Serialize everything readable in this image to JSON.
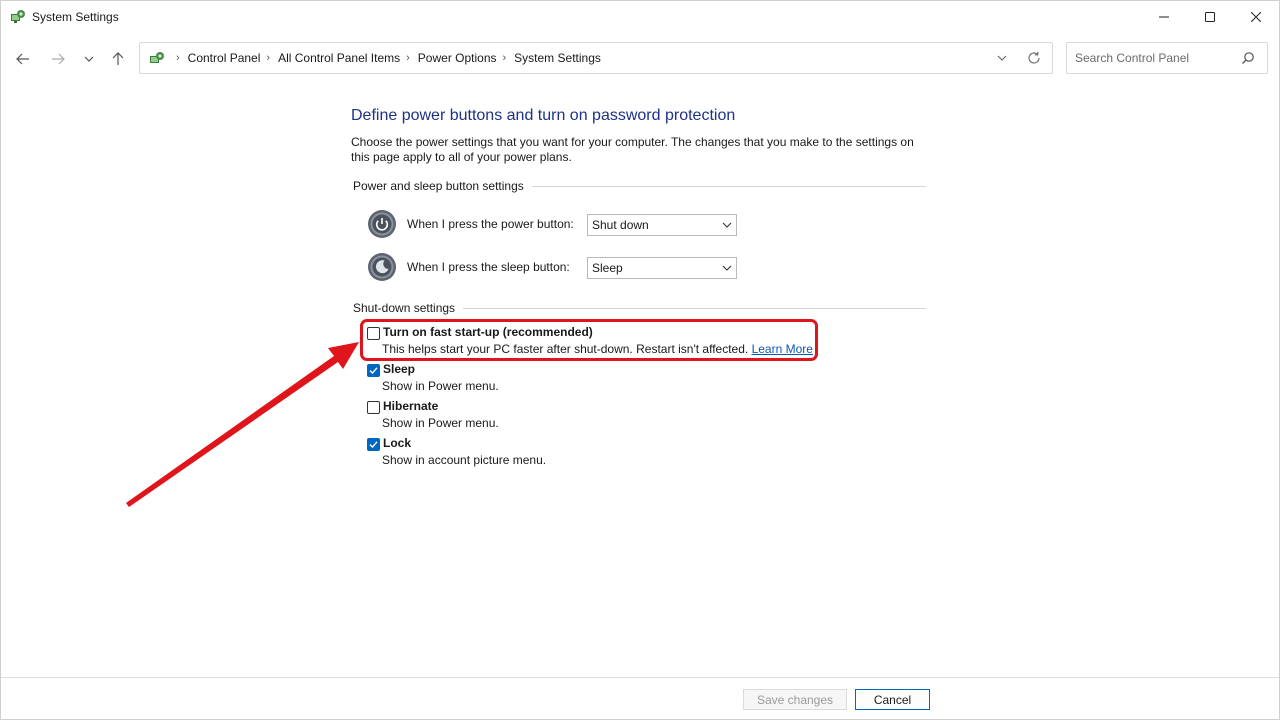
{
  "window": {
    "title": "System Settings"
  },
  "nav": {
    "breadcrumbs": [
      "Control Panel",
      "All Control Panel Items",
      "Power Options",
      "System Settings"
    ],
    "search_placeholder": "Search Control Panel"
  },
  "page": {
    "title": "Define power buttons and turn on password protection",
    "description": "Choose the power settings that you want for your computer. The changes that you make to the settings on this page apply to all of your power plans."
  },
  "power_group": {
    "heading": "Power and sleep button settings",
    "rows": [
      {
        "label": "When I press the power button:",
        "value": "Shut down"
      },
      {
        "label": "When I press the sleep button:",
        "value": "Sleep"
      }
    ]
  },
  "shutdown_group": {
    "heading": "Shut-down settings",
    "items": [
      {
        "title": "Turn on fast start-up (recommended)",
        "desc": "This helps start your PC faster after shut-down. Restart isn't affected.",
        "link": "Learn More",
        "checked": false
      },
      {
        "title": "Sleep",
        "desc": "Show in Power menu.",
        "checked": true
      },
      {
        "title": "Hibernate",
        "desc": "Show in Power menu.",
        "checked": false
      },
      {
        "title": "Lock",
        "desc": "Show in account picture menu.",
        "checked": true
      }
    ]
  },
  "footer": {
    "save_label": "Save changes",
    "cancel_label": "Cancel"
  },
  "colors": {
    "accent": "#0067c0",
    "title_blue": "#1e3287",
    "annotation_red": "#e0151b"
  }
}
